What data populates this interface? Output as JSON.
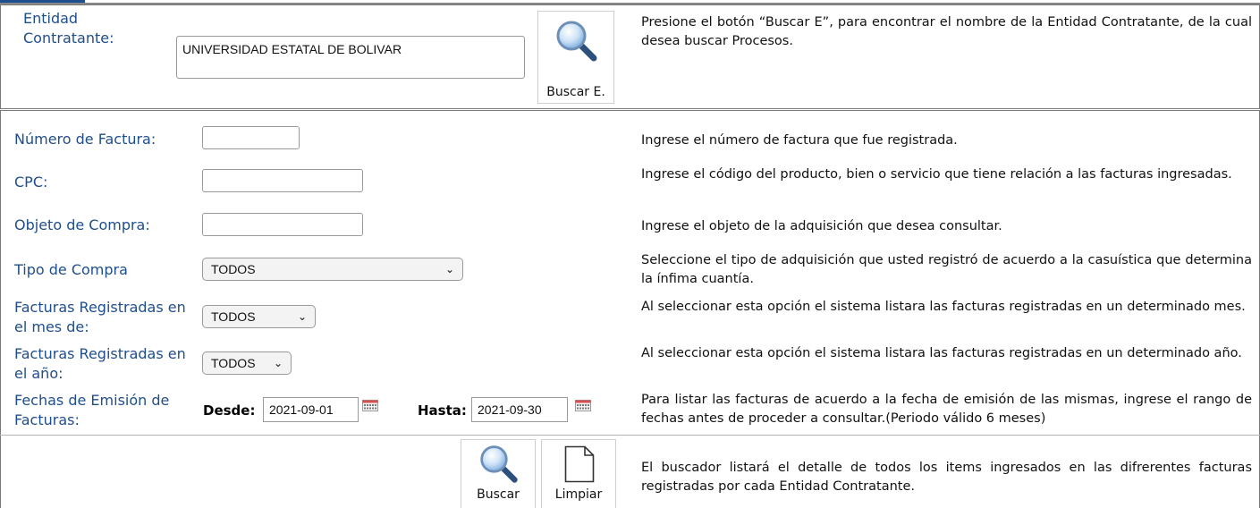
{
  "entity": {
    "label": "Entidad Contratante:",
    "value": "UNIVERSIDAD ESTATAL DE BOLIVAR",
    "search_button": "Buscar E.",
    "help": "Presione el botón “Buscar E”, para encontrar el nombre de la Entidad Contratante, de la cual desea buscar Procesos."
  },
  "fields": {
    "invoice_number": {
      "label": "Número de Factura:",
      "value": "",
      "help": "Ingrese el número de factura que fue registrada."
    },
    "cpc": {
      "label": "CPC:",
      "value": "",
      "help": "Ingrese el código del producto, bien o servicio que tiene relación a las facturas ingresadas."
    },
    "purchase_object": {
      "label": "Objeto de Compra:",
      "value": "",
      "help": "Ingrese el objeto de la adquisición que desea consultar."
    },
    "purchase_type": {
      "label": "Tipo de Compra",
      "value": "TODOS",
      "help": "Seleccione el tipo de adquisición que usted registró de acuerdo a la casuística que determina la ínfima cuantía."
    },
    "month": {
      "label": "Facturas Registradas en el mes de:",
      "value": "TODOS",
      "help": "Al seleccionar esta opción el sistema listara las facturas registradas en un determinado mes."
    },
    "year": {
      "label": "Facturas Registradas en el año:",
      "value": "TODOS",
      "help": "Al seleccionar esta opción el sistema listara las facturas registradas en un determinado año."
    },
    "dates": {
      "label": "Fechas de Emisión de Facturas:",
      "from_label": "Desde:",
      "from_value": "2021-09-01",
      "to_label": "Hasta:",
      "to_value": "2021-09-30",
      "help": "Para listar las facturas de acuerdo a la fecha de emisión de las mismas, ingrese el rango de fechas antes de proceder a consultar.(Periodo válido 6 meses)"
    }
  },
  "actions": {
    "search": "Buscar",
    "clear": "Limpiar",
    "help": "El buscador listará el detalle de todos los items ingresados en las difrerentes facturas registradas por cada Entidad Contratante."
  },
  "colors": {
    "label_blue": "#1f4e8c",
    "border": "#7a7a7a"
  }
}
